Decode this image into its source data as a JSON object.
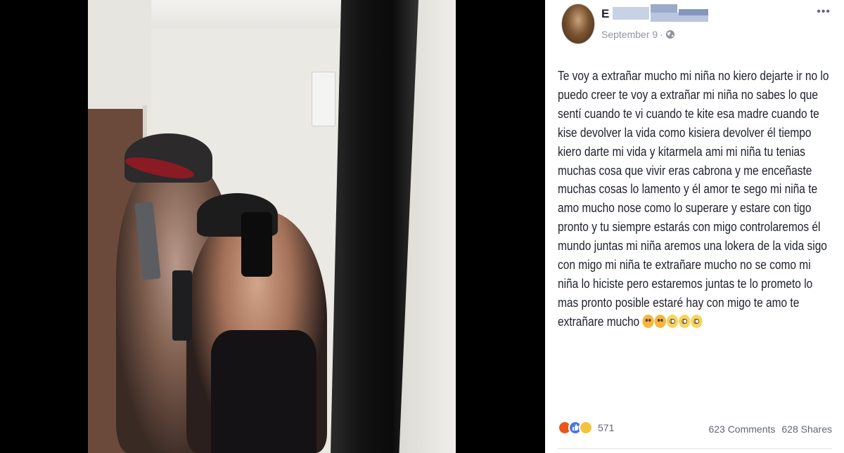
{
  "post": {
    "author": "E",
    "date": "September 9",
    "meta_separator": "·",
    "privacy_icon": "globe-icon",
    "more_icon": "•••",
    "text": "Te voy a extrañar mucho mi niña no kiero dejarte ir no lo puedo creer te voy a extrañar mi niña no sabes lo que sentí cuando te vi cuando te kite esa madre cuando te kise devolver la vida como kisiera devolver él tiempo kiero darte mi vida y kitarmela ami mi niña tu tenias muchas cosa que vivir eras cabrona y me enceñaste muchas cosas lo lamento y él amor te sego mi niña te amo mucho nose como lo superare y estare con tigo pronto y tu siempre estarás con migo controlaremos él mundo juntas mi niña aremos una lokera de la vida sigo con migo mi niña te extrañare mucho no se como mi niña lo hiciste pero estaremos juntas te lo prometo lo mas pronto posible estaré hay con migo te amo te extrañare mucho",
    "emojis": [
      "weary-face",
      "weary-face",
      "flushed-face",
      "flushed-face",
      "flushed-face"
    ],
    "reactions": {
      "icons": [
        "angry-icon",
        "like-icon",
        "sad-icon"
      ],
      "count": "571"
    },
    "comments": "623 Comments",
    "shares": "628 Shares"
  },
  "colors": {
    "text": "#1d2129",
    "meta": "#90949c",
    "like_blue": "#4a78e0",
    "angry_orange": "#e9581a"
  }
}
